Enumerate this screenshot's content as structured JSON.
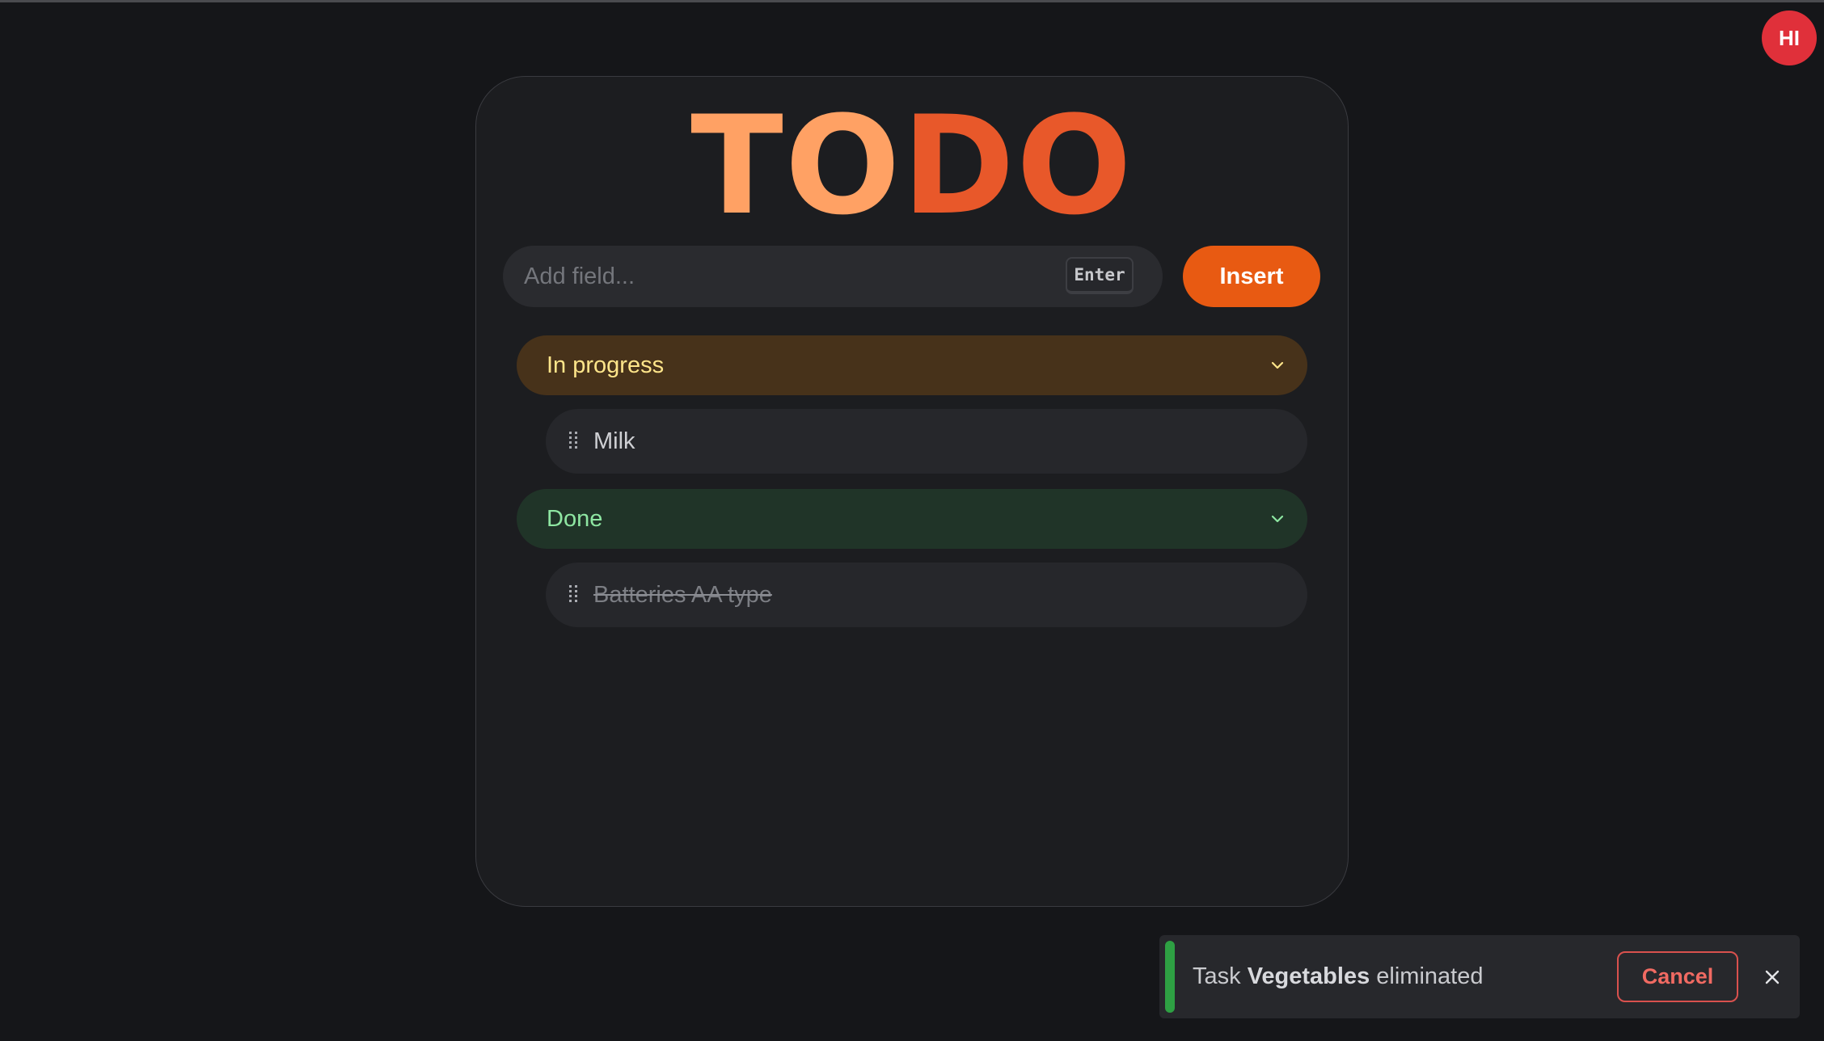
{
  "app": {
    "title_part1": "TO",
    "title_part2": "DO",
    "avatar_initials": "HI"
  },
  "add_form": {
    "placeholder": "Add field...",
    "value": "",
    "shortcut_hint": "Enter",
    "insert_label": "Insert"
  },
  "groups": [
    {
      "label": "In progress",
      "icon": "chevron-down-icon",
      "color": "#ffe58a",
      "background": "#47321a",
      "tasks": [
        {
          "label": "Milk",
          "done": false
        }
      ]
    },
    {
      "label": "Done",
      "icon": "chevron-down-icon",
      "color": "#8ee6a2",
      "background": "#203428",
      "tasks": [
        {
          "label": "Batteries AA type",
          "done": true
        }
      ]
    }
  ],
  "toast": {
    "prefix": "Task ",
    "task_name": "Vegetables",
    "suffix": " eliminated",
    "cancel_label": "Cancel",
    "status_color": "#2ea043",
    "close_icon": "close-icon"
  },
  "colors": {
    "accent": "#e85a12",
    "title_light": "#ffa164",
    "title_dark": "#e8582a",
    "avatar": "#e0303a"
  }
}
